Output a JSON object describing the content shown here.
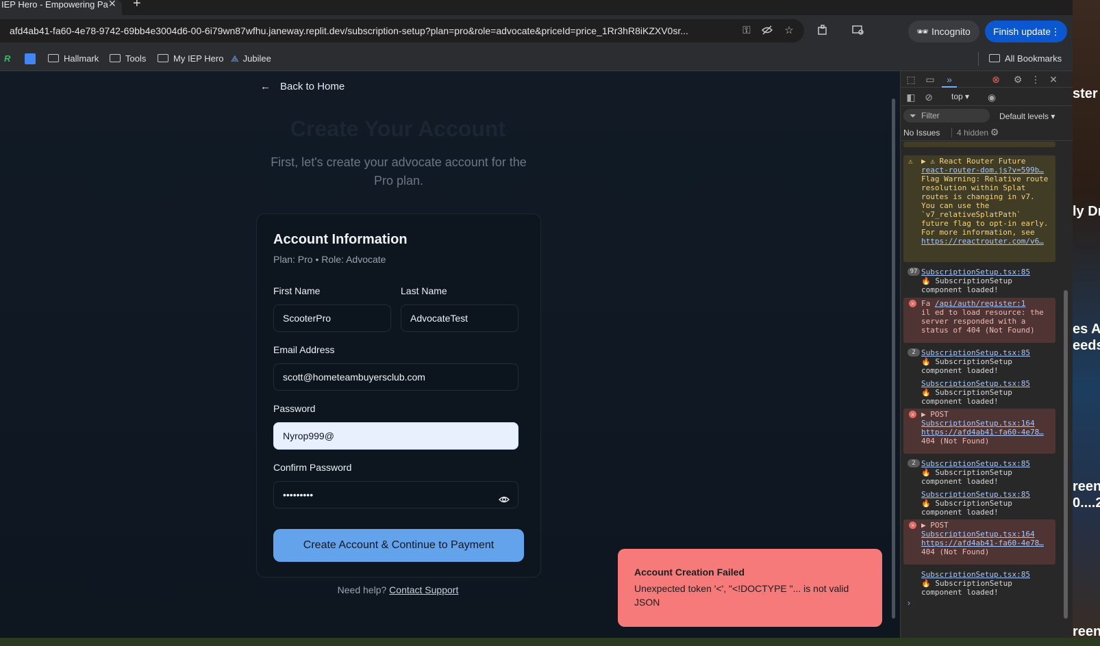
{
  "browser": {
    "tab_title": "IEP Hero - Empowering Pa",
    "tab_close": "✕",
    "new_tab": "+",
    "url": "afd4ab41-fa60-4e78-9742-69bb4e3004d6-00-6i79wn87wfhu.janeway.replit.dev/subscription-setup?plan=pro&role=advocate&priceId=price_1Rr3hR8iKZXV0sr...",
    "incognito_label": "Incognito",
    "finish_update_label": "Finish update",
    "bookmarks": [
      "Hallmark",
      "Tools",
      "My IEP Hero",
      "Jubilee"
    ],
    "all_bookmarks_label": "All Bookmarks"
  },
  "page": {
    "back_label": "Back to Home",
    "title": "Create Your Account",
    "subtitle": "First, let's create your advocate account for the Pro plan.",
    "card": {
      "title": "Account Information",
      "subtitle": "Plan: Pro • Role: Advocate",
      "first_name_label": "First Name",
      "first_name_value": "ScooterPro",
      "last_name_label": "Last Name",
      "last_name_value": "AdvocateTest",
      "email_label": "Email Address",
      "email_value": "scott@hometeambuyersclub.com",
      "password_label": "Password",
      "password_value": "Nyrop999@",
      "confirm_label": "Confirm Password",
      "confirm_value": "•••••••••",
      "submit_label": "Create Account & Continue to Payment"
    },
    "help_text": "Need help?",
    "help_link": "Contact Support",
    "toast": {
      "title": "Account Creation Failed",
      "message": "Unexpected token '<', \"<!DOCTYPE \"... is not valid JSON"
    }
  },
  "devtools": {
    "context": "top ▾",
    "filter_placeholder": "Filter",
    "levels": "Default levels ▾",
    "issues": "No Issues",
    "hidden": "4 hidden",
    "messages": {
      "warn_title": "▶ ⚠ React Router Future",
      "warn_link": "react-router-dom.js?v=599b…",
      "warn_body": "Flag Warning: Relative route resolution within Splat routes is changing in v7. You can use the `v7_relativeSplatPath` future flag to opt-in early. For more information, see",
      "warn_link2": "https://reactrouter.com/v6…",
      "m1_badge": "97",
      "m1_link": "SubscriptionSetup.tsx:85",
      "m1_text": "🔥 SubscriptionSetup component loaded!",
      "e1_prefix": "Fa",
      "e1_link": "/api/auth/register:1",
      "e1_text": "il ed to load resource: the server responded with a status of 404 (Not Found)",
      "m2_badge": "2",
      "m2_link": "SubscriptionSetup.tsx:85",
      "m2_text": "🔥 SubscriptionSetup component loaded!",
      "m3_link": "SubscriptionSetup.tsx:85",
      "m3_text": "🔥 SubscriptionSetup component loaded!",
      "e2_title": "▶ POST",
      "e2_link": "SubscriptionSetup.tsx:164",
      "e2_url": "https://afd4ab41-fa60-4e78…",
      "e2_status": "404 (Not Found)",
      "m4_badge": "2",
      "m4_link": "SubscriptionSetup.tsx:85",
      "m4_text": "🔥 SubscriptionSetup component loaded!",
      "m5_link": "SubscriptionSetup.tsx:85",
      "m5_text": "🔥 SubscriptionSetup component loaded!",
      "e3_title": "▶ POST",
      "e3_link": "SubscriptionSetup.tsx:164",
      "e3_url": "https://afd4ab41-fa60-4e78…",
      "e3_status": "404 (Not Found)",
      "m6_link": "SubscriptionSetup.tsx:85",
      "m6_text": "🔥 SubscriptionSetup component loaded!"
    }
  },
  "background_text": {
    "a": "ster",
    "b": "ly Dr",
    "c": "es All",
    "d": "eeds",
    "e": "reen",
    "f": "0....2",
    "g": "reen"
  },
  "colors": {
    "accent": "#63a3ec",
    "toast": "#f77a7a",
    "chrome_accent": "#0b57d0"
  }
}
